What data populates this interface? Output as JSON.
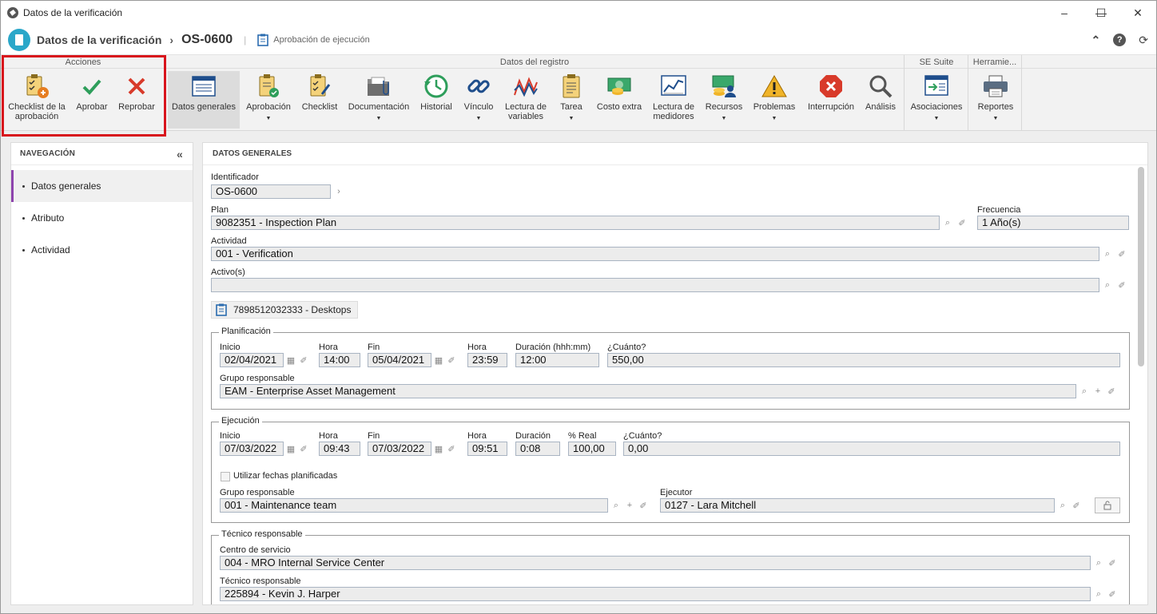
{
  "window": {
    "title": "Datos de la verificación"
  },
  "header": {
    "title": "Datos de la verificación",
    "record_id": "OS-0600",
    "subtitle": "Aprobación de ejecución"
  },
  "ribbon": {
    "groups": {
      "acciones": "Acciones",
      "datos_registro": "Datos del registro",
      "se_suite": "SE Suite",
      "herramientas": "Herramie..."
    },
    "buttons": {
      "checklist_aprobacion": "Checklist de la aprobación",
      "aprobar": "Aprobar",
      "reprobar": "Reprobar",
      "datos_generales": "Datos generales",
      "aprobacion": "Aprobación",
      "checklist": "Checklist",
      "documentacion": "Documentación",
      "historial": "Historial",
      "vinculo": "Vínculo",
      "lectura_variables": "Lectura de variables",
      "tarea": "Tarea",
      "costo_extra": "Costo extra",
      "lectura_medidores": "Lectura de medidores",
      "recursos": "Recursos",
      "problemas": "Problemas",
      "interrupcion": "Interrupción",
      "analisis": "Análisis",
      "asociaciones": "Asociaciones",
      "reportes": "Reportes"
    }
  },
  "nav": {
    "title": "NAVEGACIÓN",
    "items": [
      {
        "label": "Datos generales"
      },
      {
        "label": "Atributo"
      },
      {
        "label": "Actividad"
      }
    ]
  },
  "main": {
    "title": "DATOS GENERALES",
    "identificador": {
      "label": "Identificador",
      "value": "OS-0600"
    },
    "plan": {
      "label": "Plan",
      "value": "9082351 - Inspection Plan"
    },
    "frecuencia": {
      "label": "Frecuencia",
      "value": "1 Año(s)"
    },
    "actividad": {
      "label": "Actividad",
      "value": "001 - Verification"
    },
    "activos": {
      "label": "Activo(s)",
      "value": ""
    },
    "chip": "7898512032333 - Desktops",
    "planificacion": {
      "title": "Planificación",
      "inicio_label": "Inicio",
      "inicio": "02/04/2021",
      "hora1_label": "Hora",
      "hora1": "14:00",
      "fin_label": "Fin",
      "fin": "05/04/2021",
      "hora2_label": "Hora",
      "hora2": "23:59",
      "duracion_label": "Duración (hhh:mm)",
      "duracion": "12:00",
      "cuanto_label": "¿Cuánto?",
      "cuanto": "550,00",
      "grupo_label": "Grupo responsable",
      "grupo": "EAM - Enterprise Asset Management"
    },
    "ejecucion": {
      "title": "Ejecución",
      "inicio_label": "Inicio",
      "inicio": "07/03/2022",
      "hora1_label": "Hora",
      "hora1": "09:43",
      "fin_label": "Fin",
      "fin": "07/03/2022",
      "hora2_label": "Hora",
      "hora2": "09:51",
      "duracion_label": "Duración",
      "duracion": "0:08",
      "real_label": "% Real",
      "real": "100,00",
      "cuanto_label": "¿Cuánto?",
      "cuanto": "0,00",
      "usar_fechas": "Utilizar fechas planificadas",
      "grupo_label": "Grupo responsable",
      "grupo": "001 - Maintenance team",
      "ejecutor_label": "Ejecutor",
      "ejecutor": "0127 - Lara Mitchell"
    },
    "tecnico": {
      "title": "Técnico responsable",
      "centro_label": "Centro de servicio",
      "centro": "004 - MRO Internal Service Center",
      "tecnico_label": "Técnico responsable",
      "tecnico": "225894 - Kevin J. Harper"
    }
  },
  "colors": {
    "accent": "#8e44ad",
    "highlight": "#d8141c",
    "approve": "#2e9e5b",
    "reject": "#d83a2a"
  }
}
